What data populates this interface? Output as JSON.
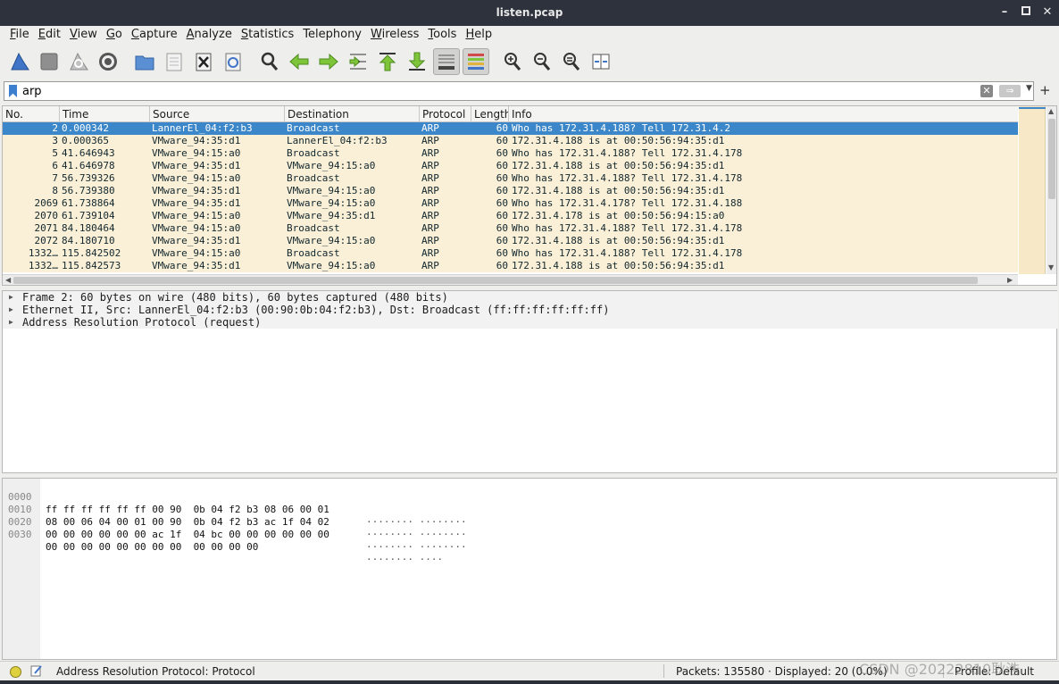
{
  "window": {
    "title": "listen.pcap",
    "buttons": {
      "minimize": "–",
      "maximize": "▫",
      "close": "✕"
    }
  },
  "menu": [
    {
      "acc": "F",
      "rest": "ile"
    },
    {
      "acc": "E",
      "rest": "dit"
    },
    {
      "acc": "V",
      "rest": "iew"
    },
    {
      "acc": "G",
      "rest": "o"
    },
    {
      "acc": "C",
      "rest": "apture"
    },
    {
      "acc": "A",
      "rest": "nalyze"
    },
    {
      "acc": "S",
      "rest": "tatistics"
    },
    {
      "acc": "",
      "rest": "Telephony"
    },
    {
      "acc": "W",
      "rest": "ireless"
    },
    {
      "acc": "T",
      "rest": "ools"
    },
    {
      "acc": "H",
      "rest": "elp"
    }
  ],
  "filter": {
    "value": "arp",
    "placeholder": ""
  },
  "columns": {
    "no": "No.",
    "time": "Time",
    "source": "Source",
    "destination": "Destination",
    "protocol": "Protocol",
    "length": "Length",
    "info": "Info"
  },
  "packets": [
    {
      "no": "2",
      "time": "0.000342",
      "src": "LannerEl_04:f2:b3",
      "dst": "Broadcast",
      "proto": "ARP",
      "len": "60",
      "info": "Who has 172.31.4.188? Tell 172.31.4.2"
    },
    {
      "no": "3",
      "time": "0.000365",
      "src": "VMware_94:35:d1",
      "dst": "LannerEl_04:f2:b3",
      "proto": "ARP",
      "len": "60",
      "info": "172.31.4.188 is at 00:50:56:94:35:d1"
    },
    {
      "no": "5",
      "time": "41.646943",
      "src": "VMware_94:15:a0",
      "dst": "Broadcast",
      "proto": "ARP",
      "len": "60",
      "info": "Who has 172.31.4.188? Tell 172.31.4.178"
    },
    {
      "no": "6",
      "time": "41.646978",
      "src": "VMware_94:35:d1",
      "dst": "VMware_94:15:a0",
      "proto": "ARP",
      "len": "60",
      "info": "172.31.4.188 is at 00:50:56:94:35:d1"
    },
    {
      "no": "7",
      "time": "56.739326",
      "src": "VMware_94:15:a0",
      "dst": "Broadcast",
      "proto": "ARP",
      "len": "60",
      "info": "Who has 172.31.4.188? Tell 172.31.4.178"
    },
    {
      "no": "8",
      "time": "56.739380",
      "src": "VMware_94:35:d1",
      "dst": "VMware_94:15:a0",
      "proto": "ARP",
      "len": "60",
      "info": "172.31.4.188 is at 00:50:56:94:35:d1"
    },
    {
      "no": "2069",
      "time": "61.738864",
      "src": "VMware_94:35:d1",
      "dst": "VMware_94:15:a0",
      "proto": "ARP",
      "len": "60",
      "info": "Who has 172.31.4.178? Tell 172.31.4.188"
    },
    {
      "no": "2070",
      "time": "61.739104",
      "src": "VMware_94:15:a0",
      "dst": "VMware_94:35:d1",
      "proto": "ARP",
      "len": "60",
      "info": "172.31.4.178 is at 00:50:56:94:15:a0"
    },
    {
      "no": "2071",
      "time": "84.180464",
      "src": "VMware_94:15:a0",
      "dst": "Broadcast",
      "proto": "ARP",
      "len": "60",
      "info": "Who has 172.31.4.188? Tell 172.31.4.178"
    },
    {
      "no": "2072",
      "time": "84.180710",
      "src": "VMware_94:35:d1",
      "dst": "VMware_94:15:a0",
      "proto": "ARP",
      "len": "60",
      "info": "172.31.4.188 is at 00:50:56:94:35:d1"
    },
    {
      "no": "1332…",
      "time": "115.842502",
      "src": "VMware_94:15:a0",
      "dst": "Broadcast",
      "proto": "ARP",
      "len": "60",
      "info": "Who has 172.31.4.188? Tell 172.31.4.178"
    },
    {
      "no": "1332…",
      "time": "115.842573",
      "src": "VMware_94:35:d1",
      "dst": "VMware_94:15:a0",
      "proto": "ARP",
      "len": "60",
      "info": "172.31.4.188 is at 00:50:56:94:35:d1"
    }
  ],
  "selected_index": 0,
  "details": [
    "Frame 2: 60 bytes on wire (480 bits), 60 bytes captured (480 bits)",
    "Ethernet II, Src: LannerEl_04:f2:b3 (00:90:0b:04:f2:b3), Dst: Broadcast (ff:ff:ff:ff:ff:ff)",
    "Address Resolution Protocol (request)"
  ],
  "bytes": [
    {
      "off": "0000",
      "hex": "ff ff ff ff ff ff 00 90  0b 04 f2 b3 08 06 00 01",
      "ascii": "········ ········"
    },
    {
      "off": "0010",
      "hex": "08 00 06 04 00 01 00 90  0b 04 f2 b3 ac 1f 04 02",
      "ascii": "········ ········"
    },
    {
      "off": "0020",
      "hex": "00 00 00 00 00 00 ac 1f  04 bc 00 00 00 00 00 00",
      "ascii": "········ ········"
    },
    {
      "off": "0030",
      "hex": "00 00 00 00 00 00 00 00  00 00 00 00",
      "ascii": "········ ····"
    }
  ],
  "status": {
    "field": "Address Resolution Protocol: Protocol",
    "packets": "Packets: 135580 · Displayed: 20 (0.0%)",
    "profile": "Profile: Default"
  },
  "watermark": "CSDN @20222810耿浩",
  "colors": {
    "row_bg": "#faf0d7",
    "selected": "#3b87c9",
    "titlebar": "#2d323c"
  },
  "toolbar_icons": [
    "shark-fin-start-icon",
    "stop-square-icon",
    "restart-fin-icon",
    "capture-options-gear-icon",
    "open-folder-icon",
    "save-file-icon",
    "close-file-icon",
    "reload-icon",
    "find-packet-icon",
    "go-back-arrow-icon",
    "go-forward-arrow-icon",
    "go-to-packet-icon",
    "go-first-icon",
    "go-last-icon",
    "autoscroll-icon",
    "colorize-icon",
    "zoom-in-icon",
    "zoom-out-icon",
    "zoom-normal-icon",
    "resize-columns-icon"
  ]
}
